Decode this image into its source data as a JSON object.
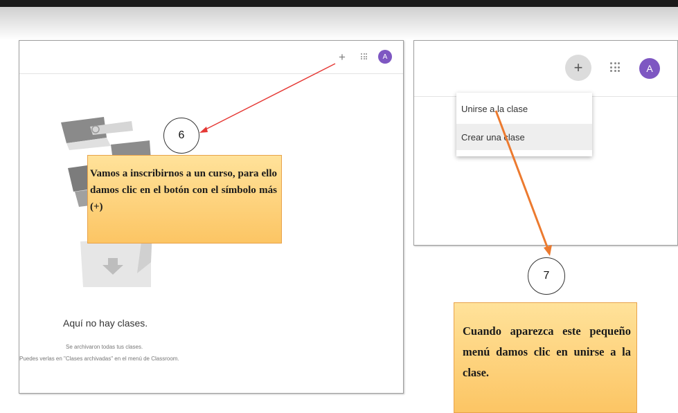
{
  "left_panel": {
    "avatar_letter": "A",
    "plus_symbol": "+",
    "empty_title": "Aquí no hay clases.",
    "empty_line1": "Se archivaron todas tus clases.",
    "empty_line2": "Puedes verlas en \"Clases archivadas\" en el menú de Classroom."
  },
  "right_panel": {
    "avatar_letter": "A",
    "plus_symbol": "+",
    "menu": {
      "join_label": "Unirse a la clase",
      "create_label": "Crear una clase"
    }
  },
  "steps": [
    {
      "number": "6",
      "text": "Vamos a inscribirnos a un curso, para ello damos clic en el botón con el símbolo más (+)"
    },
    {
      "number": "7",
      "text": "Cuando aparezca este pequeño menú damos clic en unirse a la clase."
    }
  ],
  "colors": {
    "arrow_red": "#e53935",
    "arrow_orange": "#ec7a2f",
    "avatar": "#7e57c2",
    "callout_fill": "#fcc564"
  }
}
